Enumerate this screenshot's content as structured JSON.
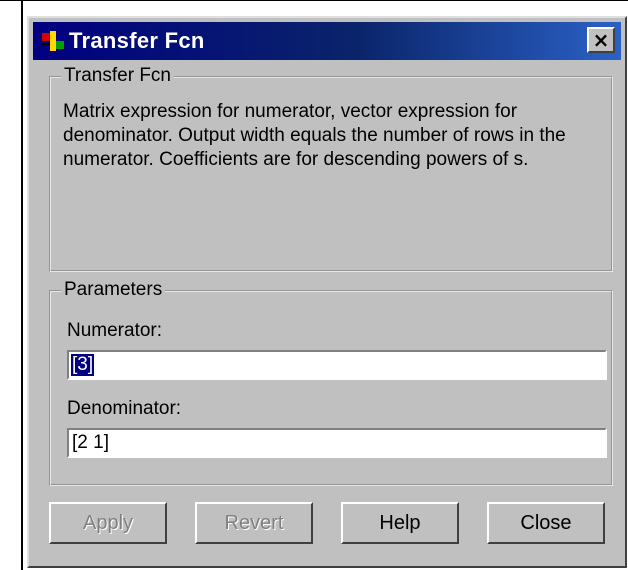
{
  "window": {
    "title": "Transfer Fcn",
    "app_icon": "simulink-block-icon",
    "close_glyph": "×"
  },
  "description_group": {
    "legend": "Transfer Fcn",
    "text": "Matrix expression for numerator, vector expression for denominator.  Output width equals the number of rows in the numerator.  Coefficients are for descending powers of s."
  },
  "parameters_group": {
    "legend": "Parameters",
    "numerator": {
      "label": "Numerator:",
      "value": "[3]"
    },
    "denominator": {
      "label": "Denominator:",
      "value": "[2 1]"
    }
  },
  "buttons": {
    "apply": "Apply",
    "revert": "Revert",
    "help": "Help",
    "close": "Close"
  },
  "colors": {
    "titlebar_start": "#000080",
    "titlebar_end": "#2b61c6",
    "face": "#c0c0c0",
    "selection": "#000080",
    "disabled_text": "#808080"
  }
}
